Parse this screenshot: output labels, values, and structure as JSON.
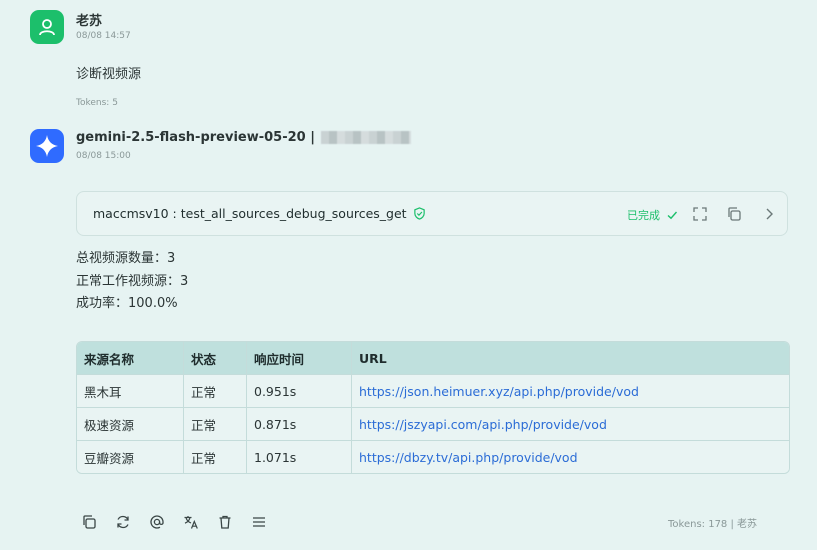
{
  "user_message": {
    "author": "老苏",
    "time": "08/08 14:57",
    "text": "诊断视频源",
    "tokens": "Tokens: 5"
  },
  "ai_message": {
    "model": "gemini-2.5-flash-preview-05-20 |",
    "time": "08/08 15:00",
    "tool_call": {
      "name": "maccmsv10 : test_all_sources_debug_sources_get",
      "status": "已完成",
      "status_color": "#1cbf6b"
    },
    "stats": [
      "总视频源数量：3",
      "正常工作视频源：3",
      "成功率：100.0%"
    ],
    "table": {
      "headers": [
        "来源名称",
        "状态",
        "响应时间",
        "URL"
      ],
      "rows": [
        [
          "黑木耳",
          "正常",
          "0.951s",
          "https://json.heimuer.xyz/api.php/provide/vod"
        ],
        [
          "极速资源",
          "正常",
          "0.871s",
          "https://jszyapi.com/api.php/provide/vod"
        ],
        [
          "豆瓣资源",
          "正常",
          "1.071s",
          "https://dbzy.tv/api.php/provide/vod"
        ]
      ]
    },
    "actions": [
      "copy-icon",
      "refresh-icon",
      "mention-icon",
      "translate-icon",
      "delete-icon",
      "menu-icon"
    ],
    "footer": "Tokens: 178 | 老苏"
  },
  "colors": {
    "background": "#e6f3f2",
    "user_avatar": "#1cbf6b",
    "ai_avatar": "#2f6bff",
    "table_header": "#bfe0dd",
    "link": "#2b6cd6"
  }
}
